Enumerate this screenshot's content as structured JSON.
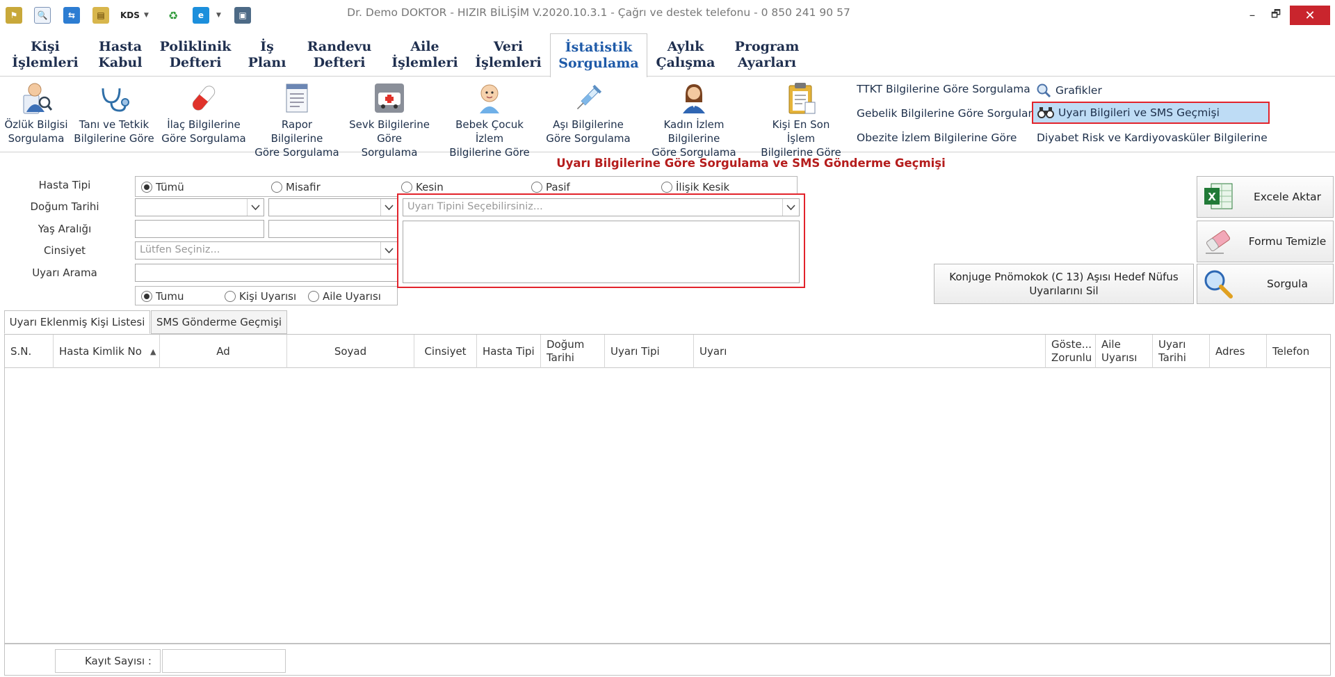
{
  "window": {
    "title": "Dr. Demo DOKTOR - HIZIR BİLİŞİM V.2020.10.3.1 - Çağrı ve destek telefonu - 0 850 241 90 57",
    "kds_label": "KDS",
    "minimize": "–",
    "restore": "🗗",
    "close": "✕"
  },
  "tabs": [
    {
      "line1": "Kişi",
      "line2": "İşlemleri"
    },
    {
      "line1": "Hasta",
      "line2": "Kabul"
    },
    {
      "line1": "Poliklinik",
      "line2": "Defteri"
    },
    {
      "line1": "İş",
      "line2": "Planı"
    },
    {
      "line1": "Randevu",
      "line2": "Defteri"
    },
    {
      "line1": "Aile",
      "line2": "İşlemleri"
    },
    {
      "line1": "Veri",
      "line2": "İşlemleri"
    },
    {
      "line1": "İstatistik",
      "line2": "Sorgulama"
    },
    {
      "line1": "Aylık",
      "line2": "Çalışma"
    },
    {
      "line1": "Program",
      "line2": "Ayarları"
    }
  ],
  "ribbon": {
    "buttons": [
      {
        "line1": "Özlük Bilgisi",
        "line2": "Sorgulama",
        "icon": "doctor-icon"
      },
      {
        "line1": "Tanı ve Tetkik",
        "line2": "Bilgilerine Göre",
        "icon": "stethoscope-icon"
      },
      {
        "line1": "İlaç Bilgilerine",
        "line2": "Göre Sorgulama",
        "icon": "pill-icon"
      },
      {
        "line1": "Rapor Bilgilerine",
        "line2": "Göre Sorgulama",
        "icon": "report-icon"
      },
      {
        "line1": "Sevk Bilgilerine",
        "line2": "Göre Sorgulama",
        "icon": "ambulance-icon"
      },
      {
        "line1": "Bebek Çocuk İzlem",
        "line2": "Bilgilerine Göre",
        "icon": "baby-icon"
      },
      {
        "line1": "Aşı Bilgilerine",
        "line2": "Göre Sorgulama",
        "icon": "syringe-icon"
      },
      {
        "line1": "Kadın İzlem Bilgilerine",
        "line2": "Göre Sorgulama",
        "icon": "woman-icon"
      },
      {
        "line1": "Kişi En Son İşlem",
        "line2": "Bilgilerine Göre",
        "icon": "clipboard-icon"
      }
    ],
    "links": {
      "ttkt": "TTKT Bilgilerine Göre Sorgulama",
      "gebelik": "Gebelik Bilgilerine Göre Sorgulama",
      "obezite": "Obezite İzlem Bilgilerine Göre",
      "grafikler": "Grafikler",
      "uyari_sms": "Uyarı Bilgileri ve SMS Geçmişi",
      "diyabet": "Diyabet Risk ve Kardiyovasküler Bilgilerine"
    }
  },
  "form": {
    "title": "Uyarı Bilgilerine Göre Sorgulama ve SMS Gönderme Geçmişi",
    "labels": {
      "hasta_tipi": "Hasta Tipi",
      "dogum_tarihi": "Doğum Tarihi",
      "yas_araligi": "Yaş Aralığı",
      "cinsiyet": "Cinsiyet",
      "uyari_arama": "Uyarı Arama"
    },
    "hasta_tipi_options": [
      "Tümü",
      "Misafir",
      "Kesin",
      "Pasif",
      "İlişik Kesik"
    ],
    "cinsiyet_placeholder": "Lütfen Seçiniz...",
    "uyari_tipi_placeholder": "Uyarı Tipini Seçebilirsiniz...",
    "uyari_scope_options": [
      "Tumu",
      "Kişi Uyarısı",
      "Aile Uyarısı"
    ]
  },
  "actions": {
    "excel": "Excele Aktar",
    "temizle": "Formu Temizle",
    "sorgula": "Sorgula",
    "konjuge_line1": "Konjuge Pnömokok (C 13) Aşısı Hedef Nüfus",
    "konjuge_line2": "Uyarılarını Sil"
  },
  "lower_tabs": [
    "Uyarı Eklenmiş Kişi Listesi",
    "SMS Gönderme Geçmişi"
  ],
  "grid": {
    "columns": [
      {
        "line1": "S.N.",
        "line2": ""
      },
      {
        "line1": "Hasta Kimlik No",
        "line2": ""
      },
      {
        "line1": "Ad",
        "line2": ""
      },
      {
        "line1": "Soyad",
        "line2": ""
      },
      {
        "line1": "Cinsiyet",
        "line2": ""
      },
      {
        "line1": "Hasta Tipi",
        "line2": ""
      },
      {
        "line1": "Doğum",
        "line2": "Tarihi"
      },
      {
        "line1": "Uyarı Tipi",
        "line2": ""
      },
      {
        "line1": "Uyarı",
        "line2": ""
      },
      {
        "line1": "Göste...",
        "line2": "Zorunlu"
      },
      {
        "line1": "Aile",
        "line2": "Uyarısı"
      },
      {
        "line1": "Uyarı",
        "line2": "Tarihi"
      },
      {
        "line1": "Adres",
        "line2": ""
      },
      {
        "line1": "Telefon",
        "line2": ""
      }
    ],
    "sort_indicator": "▲"
  },
  "footer": {
    "kayit_label": "Kayıt Sayısı :",
    "kayit_value": ""
  }
}
